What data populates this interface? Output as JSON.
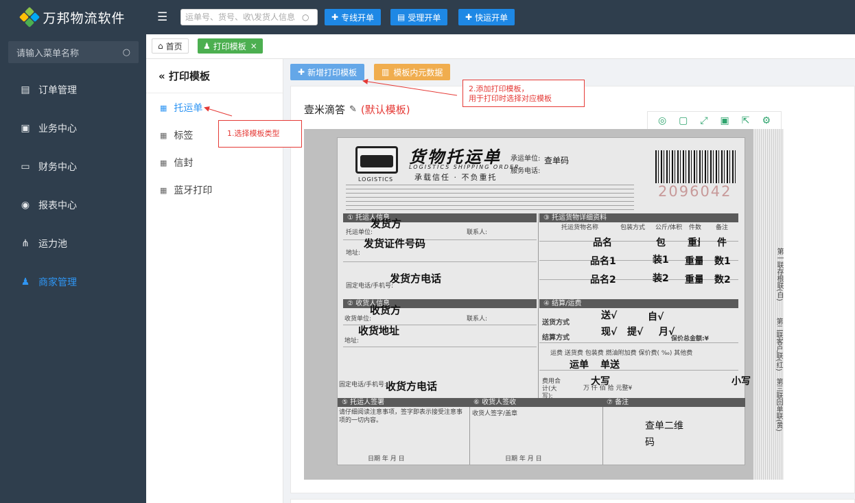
{
  "app": {
    "brand": "万邦物流软件",
    "search_placeholder": "运单号、货号、收\\发货人信息",
    "buttons": [
      {
        "label": "专线开单",
        "icon": "plus-icon"
      },
      {
        "label": "受理开单",
        "icon": "card-icon"
      },
      {
        "label": "快运开单",
        "icon": "plus-icon"
      }
    ]
  },
  "sidebar": {
    "search_placeholder": "请输入菜单名称",
    "items": [
      {
        "label": "订单管理",
        "icon": "document-icon"
      },
      {
        "label": "业务中心",
        "icon": "clipboard-icon"
      },
      {
        "label": "财务中心",
        "icon": "money-icon"
      },
      {
        "label": "报表中心",
        "icon": "eye-icon"
      },
      {
        "label": "运力池",
        "icon": "network-icon"
      },
      {
        "label": "商家管理",
        "icon": "user-icon"
      }
    ]
  },
  "tabs": {
    "home": "首页",
    "active": "打印模板"
  },
  "template_panel": {
    "title": "打印模板",
    "items": [
      "托运单",
      "标签",
      "信封",
      "蓝牙打印"
    ]
  },
  "actions": {
    "new_template": "新增打印模板",
    "template_metadata": "模板内元数据"
  },
  "card": {
    "template_name": "壹米滴答",
    "default_tag": "(默认模板)"
  },
  "annotations": {
    "step1": "1.选择模板类型",
    "step2_line1": "2.添加打印模板，",
    "step2_line2": "用于打印时选择对应模板"
  },
  "form": {
    "title": "货物托运单",
    "title_en": "LOGISTICS SHIPPING ORDER",
    "motto": "承载信任 · 不负重托",
    "logo_text": "LOGISTICS",
    "carrier_label": "承运单位:",
    "service_label": "服务电话:",
    "query_code": "查单码",
    "serial": "2096042",
    "sec1": "① 托运人信息",
    "sec2": "② 收货人信息",
    "sec3": "③ 托运货物详细资料",
    "sec4": "④ 结算/运费",
    "sec5": "⑤ 托运人签署",
    "sec6": "⑥ 收货人签收",
    "sec7": "⑦ 备注",
    "labels": {
      "sender_unit": "托运单位:",
      "contact": "联系人:",
      "address": "地址:",
      "phone": "固定电话/手机号:",
      "recv_unit": "收货单位:",
      "goods_name": "托运货物名称",
      "packing": "包装方式",
      "volume": "公斤/体积",
      "count": "件数",
      "remark": "备注",
      "delivery_mode": "送货方式",
      "settle_mode": "结算方式",
      "fees": "运费  送货费  包装费  燃油附加费  保价费(  ‰)  其他费",
      "total": "费用合计(大写):",
      "total_units": "万  仟  佰  拾  元整¥",
      "sign_note": "请仔细阅读注意事项，签字即表示接受注意事项的一切内容。",
      "receiver_sign": "收货人签字/盖章",
      "date": "日期      年    月    日",
      "date2": "日期      年    月    日",
      "insured": "保价总金额:¥",
      "side_text1": "第一联存根联(白)",
      "side_text2": "第二联客户联(红)",
      "side_text3": "第三联回单联(黄)"
    },
    "values": {
      "sender": "发货方",
      "sender_id": "发货证件号码",
      "sender_phone": "发货方电话",
      "receiver": "收货方",
      "receiver_addr": "收货地址",
      "receiver_phone": "收货方电话",
      "goods": [
        "品名",
        "品名1",
        "品名2"
      ],
      "pack": [
        "包",
        "装1",
        "装2"
      ],
      "weight": [
        "重量",
        "重量1",
        "重量2"
      ],
      "qty": [
        "件",
        "数1",
        "数2"
      ],
      "delivery": "送√",
      "self_pickup": "自√",
      "cash": "现√",
      "pickup_pay": "提√",
      "monthly": "月√",
      "freight": "运单",
      "delivery_fee": "单送",
      "daxie": "大写",
      "xiaoxie": "小写",
      "qr_note": "查单二维码"
    }
  }
}
